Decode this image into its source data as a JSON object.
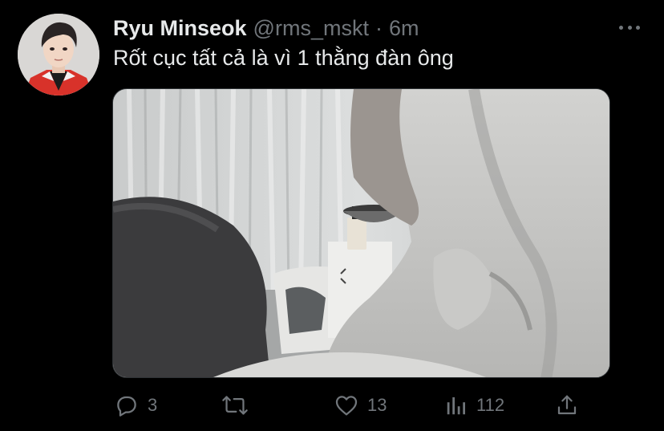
{
  "author": {
    "display_name": "Ryu Minseok",
    "handle": "@rms_mskt",
    "separator": "·",
    "time_ago": "6m"
  },
  "tweet": {
    "text": "Rốt cục tất cả là vì 1 thằng đàn ông"
  },
  "icons": {
    "more": "more-horizontal-icon",
    "reply": "reply-bubble-icon",
    "retweet": "retweet-icon",
    "like": "heart-icon",
    "views": "analytics-bars-icon",
    "share": "share-upload-icon"
  },
  "actions": {
    "reply_count": "3",
    "retweet_count": "",
    "like_count": "13",
    "views_count": "112"
  },
  "colors": {
    "background": "#000000",
    "primary_text": "#e7e9ea",
    "secondary_text": "#71767b",
    "media_border": "#2f3336"
  }
}
